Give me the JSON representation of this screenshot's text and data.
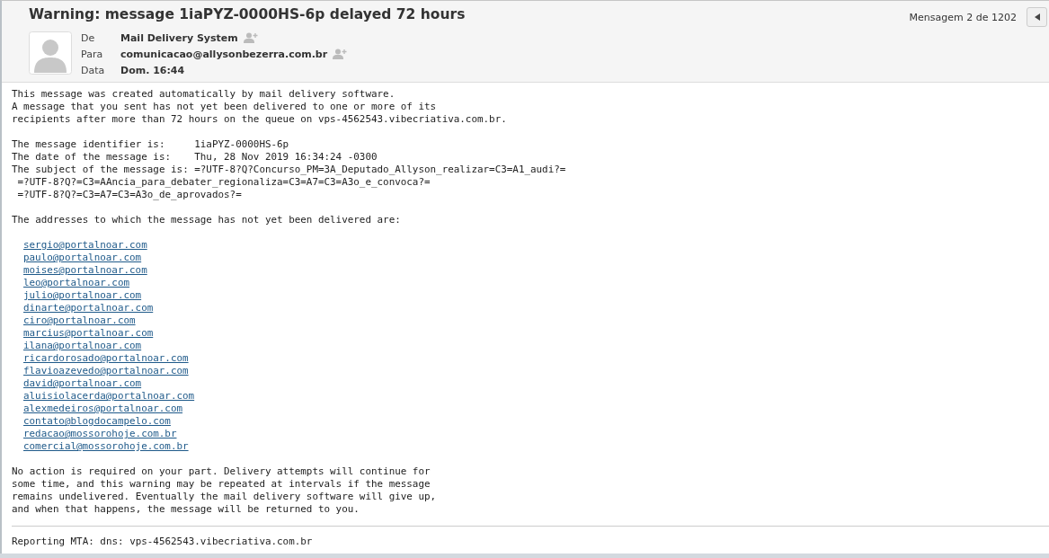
{
  "header": {
    "title": "Warning: message 1iaPYZ-0000HS-6p delayed 72 hours",
    "counter": "Mensagem 2 de 1202"
  },
  "fields": [
    {
      "label": "De",
      "value": "Mail Delivery System",
      "add_contact": true
    },
    {
      "label": "Para",
      "value": "comunicacao@allysonbezerra.com.br",
      "add_contact": true
    },
    {
      "label": "Data",
      "value": "Dom. 16:44",
      "add_contact": false
    }
  ],
  "body": [
    {
      "kind": "text",
      "text": "This message was created automatically by mail delivery software.\nA message that you sent has not yet been delivered to one or more of its\nrecipients after more than 72 hours on the queue on vps-4562543.vibecriativa.com.br."
    },
    {
      "kind": "text",
      "text": "The message identifier is:     1iaPYZ-0000HS-6p\nThe date of the message is:    Thu, 28 Nov 2019 16:34:24 -0300\nThe subject of the message is: =?UTF-8?Q?Concurso_PM=3A_Deputado_Allyson_realizar=C3=A1_audi?=\n =?UTF-8?Q?=C3=AAncia_para_debater_regionaliza=C3=A7=C3=A3o_e_convoca?=\n =?UTF-8?Q?=C3=A7=C3=A3o_de_aprovados?="
    },
    {
      "kind": "text",
      "text": "The addresses to which the message has not yet been delivered are:"
    },
    {
      "kind": "links",
      "items": [
        "sergio@portalnoar.com",
        "paulo@portalnoar.com",
        "moises@portalnoar.com",
        "leo@portalnoar.com",
        "julio@portalnoar.com",
        "dinarte@portalnoar.com",
        "ciro@portalnoar.com",
        "marcius@portalnoar.com",
        "ilana@portalnoar.com",
        "ricardorosado@portalnoar.com",
        "flavioazevedo@portalnoar.com",
        "david@portalnoar.com",
        "aluisiolacerda@portalnoar.com",
        "alexmedeiros@portalnoar.com",
        "contato@blogdocampelo.com",
        "redacao@mossorohoje.com.br",
        "comercial@mossorohoje.com.br"
      ]
    },
    {
      "kind": "text",
      "text": "No action is required on your part. Delivery attempts will continue for\nsome time, and this warning may be repeated at intervals if the message\nremains undelivered. Eventually the mail delivery software will give up,\nand when that happens, the message will be returned to you."
    },
    {
      "kind": "divider"
    },
    {
      "kind": "text",
      "text": "Reporting MTA: dns: vps-4562543.vibecriativa.com.br"
    }
  ]
}
